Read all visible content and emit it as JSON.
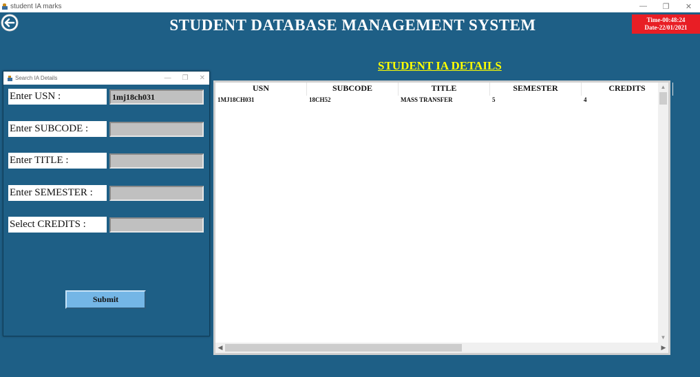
{
  "window": {
    "title": "student IA marks",
    "minimize_glyph": "—",
    "restore_glyph": "❐",
    "close_glyph": "✕"
  },
  "header": {
    "title": "STUDENT DATABASE MANAGEMENT SYSTEM",
    "time": "Time-00:48:24",
    "date": "Date-22/01/2021",
    "clock_color": "#e81e25",
    "back_icon": "arrow-left-circle-icon"
  },
  "section": {
    "title": "STUDENT IA DETAILS"
  },
  "dialog": {
    "title": "Search IA Details",
    "fields": [
      {
        "label": "Enter USN :",
        "value": "1mj18ch031"
      },
      {
        "label": "Enter SUBCODE :",
        "value": ""
      },
      {
        "label": "Enter TITLE :",
        "value": ""
      },
      {
        "label": "Enter SEMESTER :",
        "value": ""
      },
      {
        "label": "Select CREDITS :",
        "value": ""
      }
    ],
    "submit_label": "Submit"
  },
  "table": {
    "columns": [
      "USN",
      "SUBCODE",
      "TITLE",
      "SEMESTER",
      "CREDITS"
    ],
    "rows": [
      [
        "1MJ18CH031",
        "18CH52",
        "MASS TRANSFER",
        "5",
        "4"
      ]
    ]
  },
  "colors": {
    "background": "#1e5f86",
    "section_title": "#ffff00",
    "submit_button": "#74b6e6"
  }
}
